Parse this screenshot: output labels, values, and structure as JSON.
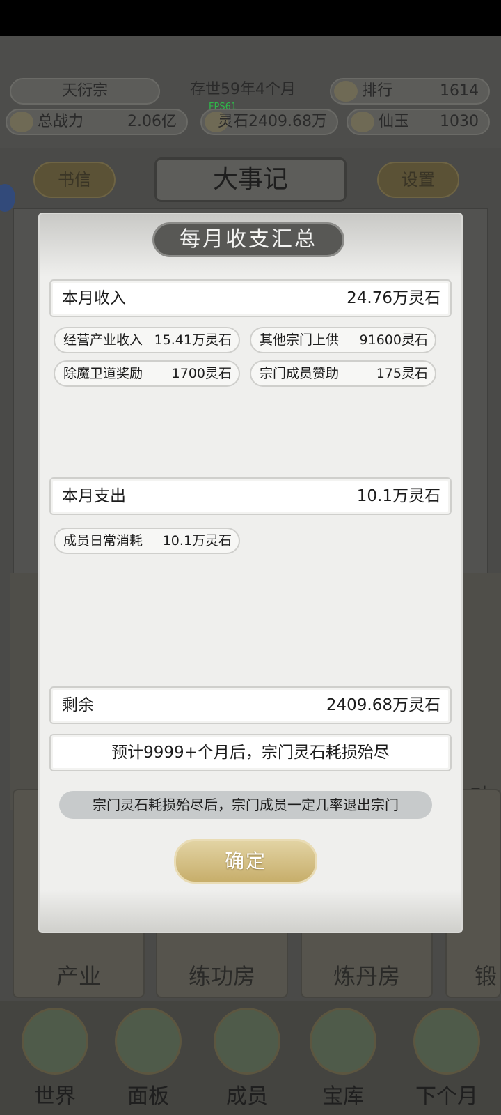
{
  "top_hud": {
    "sect_name": "天衍宗",
    "era": "存世59年4个月",
    "rank_label": "排行",
    "rank_value": "1614",
    "power_label": "总战力",
    "power_value": "2.06亿",
    "fps": "FPS61",
    "spirit_stone": "灵石2409.68万",
    "jade_label": "仙玉",
    "jade_value": "1030"
  },
  "nav": {
    "letters_label": "书信",
    "title": "大事记",
    "settings_label": "设置"
  },
  "buildings": [
    "产业",
    "练功房",
    "炼丹房",
    "锻"
  ],
  "side_partial": "功",
  "bottom_tabs": [
    "世界",
    "面板",
    "成员",
    "宝库",
    "下个月"
  ],
  "modal": {
    "title": "每月收支汇总",
    "income": {
      "label": "本月收入",
      "value": "24.76万灵石"
    },
    "income_items": [
      {
        "label": "经营产业收入",
        "value": "15.41万灵石"
      },
      {
        "label": "其他宗门上供",
        "value": "91600灵石"
      },
      {
        "label": "除魔卫道奖励",
        "value": "1700灵石"
      },
      {
        "label": "宗门成员赞助",
        "value": "175灵石"
      }
    ],
    "expense": {
      "label": "本月支出",
      "value": "10.1万灵石"
    },
    "expense_items": [
      {
        "label": "成员日常消耗",
        "value": "10.1万灵石"
      }
    ],
    "remaining": {
      "label": "剩余",
      "value": "2409.68万灵石"
    },
    "forecast": "预计9999+个月后，宗门灵石耗损殆尽",
    "warning": "宗门灵石耗损殆尽后，宗门成员一定几率退出宗门",
    "confirm_label": "确定"
  }
}
